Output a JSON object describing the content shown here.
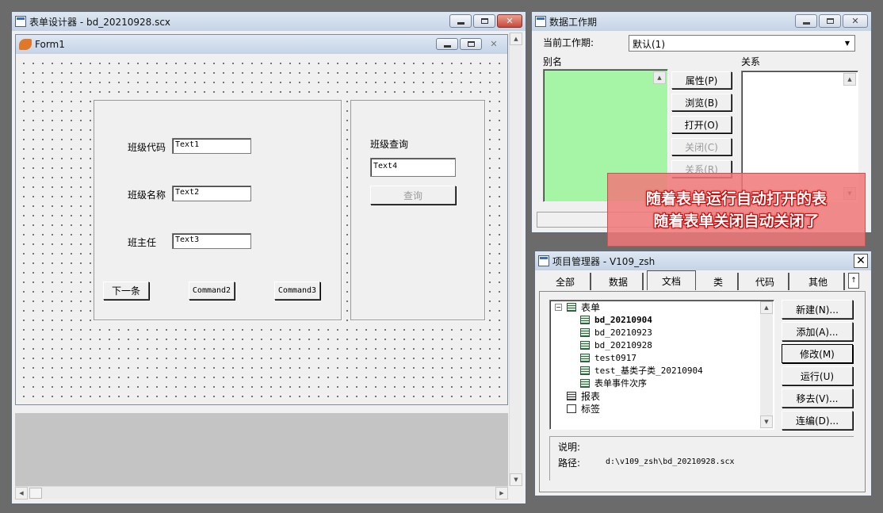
{
  "form_designer": {
    "title": "表单设计器 - bd_20210928.scx",
    "form_title": "Form1",
    "labels": {
      "class_code": "班级代码",
      "class_name": "班级名称",
      "head_teacher": "班主任",
      "class_query": "班级查询"
    },
    "textboxes": [
      "Text1",
      "Text2",
      "Text3",
      "Text4"
    ],
    "buttons": {
      "next": "下一条",
      "command2": "Command2",
      "command3": "Command3",
      "query": "查询"
    }
  },
  "data_session": {
    "title": "数据工作期",
    "current_session_label": "当前工作期:",
    "current_session_value": "默认(1)",
    "alias_label": "别名",
    "relations_label": "关系",
    "buttons": [
      "属性(P)",
      "浏览(B)",
      "打开(O)",
      "关闭(C)",
      "关系(R)"
    ],
    "disabled_buttons": [
      "关闭(C)",
      "关系(R)"
    ],
    "alias_list_color": "#a6f5a6"
  },
  "annotation": {
    "line1": "随着表单运行自动打开的表",
    "line2": "随着表单关闭自动关闭了",
    "background": "#f07878"
  },
  "project_manager": {
    "title": "项目管理器 - V109_zsh",
    "tabs": [
      "全部",
      "数据",
      "文档",
      "类",
      "代码",
      "其他"
    ],
    "active_tab": "文档",
    "tree": {
      "root": "表单",
      "root_expander": "−",
      "forms": [
        "bd_20210904",
        "bd_20210923",
        "bd_20210928",
        "test0917",
        "test_基类子类_20210904",
        "表单事件次序"
      ],
      "bold_item": "bd_20210904",
      "reports": "报表",
      "labels": "标签"
    },
    "buttons": [
      "新建(N)...",
      "添加(A)...",
      "修改(M)",
      "运行(U)",
      "移去(V)...",
      "连编(D)..."
    ],
    "description_label": "说明:",
    "path_label": "路径:",
    "path_value": "d:\\v109_zsh\\bd_20210928.scx"
  }
}
